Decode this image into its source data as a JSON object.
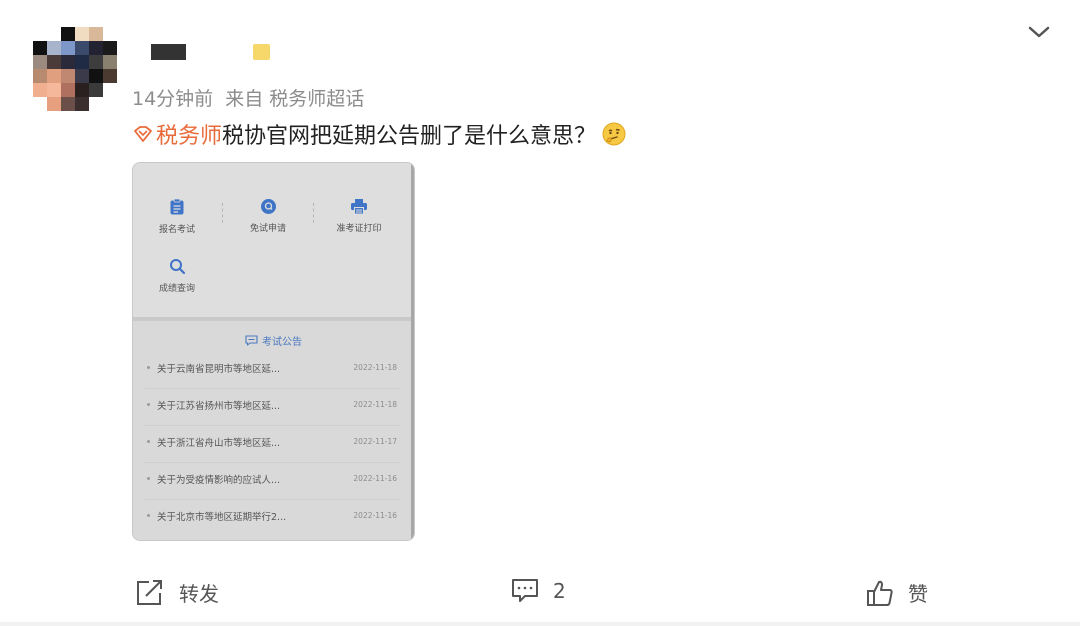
{
  "post": {
    "meta": {
      "time": "14分钟前",
      "source": "来自 税务师超话"
    },
    "topic": "税务师",
    "text": "税协官网把延期公告删了是什么意思？"
  },
  "screenshot": {
    "icons": [
      {
        "label": "报名考试",
        "icon": "clipboard-icon"
      },
      {
        "label": "免试申请",
        "icon": "badge-icon"
      },
      {
        "label": "准考证打印",
        "icon": "printer-icon"
      },
      {
        "label": "成绩查询",
        "icon": "search-icon"
      }
    ],
    "notice_title": "考试公告",
    "notices": [
      {
        "title": "关于云南省昆明市等地区延...",
        "date": "2022-11-18"
      },
      {
        "title": "关于江苏省扬州市等地区延...",
        "date": "2022-11-18"
      },
      {
        "title": "关于浙江省舟山市等地区延...",
        "date": "2022-11-17"
      },
      {
        "title": "关于为受疫情影响的应试人...",
        "date": "2022-11-16"
      },
      {
        "title": "关于北京市等地区延期举行2...",
        "date": "2022-11-16"
      }
    ]
  },
  "actions": {
    "repost": "转发",
    "comment_count": "2",
    "like": "赞"
  },
  "colors": {
    "topic": "#e86b3a",
    "accent_blue": "#4a78c0",
    "muted": "#8c8c8c"
  }
}
